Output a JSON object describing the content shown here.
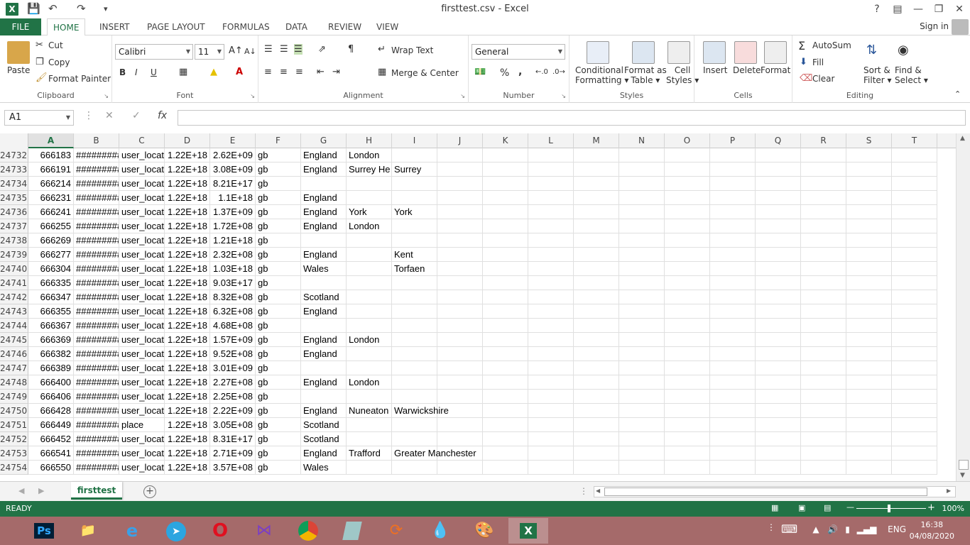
{
  "window": {
    "title": "firsttest.csv - Excel",
    "app_color": "#217346"
  },
  "tabs": [
    "FILE",
    "HOME",
    "INSERT",
    "PAGE LAYOUT",
    "FORMULAS",
    "DATA",
    "REVIEW",
    "VIEW"
  ],
  "active_tab": "HOME",
  "signin": "Sign in",
  "ribbon": {
    "clipboard": {
      "label": "Clipboard",
      "paste": "Paste",
      "cut": "Cut",
      "copy": "Copy",
      "format_painter": "Format Painter"
    },
    "font": {
      "label": "Font",
      "family": "Calibri",
      "size": "11",
      "bold": "B",
      "italic": "I",
      "underline": "U"
    },
    "alignment": {
      "label": "Alignment",
      "wrap_text": "Wrap Text",
      "merge_center": "Merge & Center"
    },
    "number": {
      "label": "Number",
      "format": "General",
      "percent": "%",
      "comma": ","
    },
    "styles": {
      "label": "Styles",
      "conditional": "Conditional",
      "conditional2": "Formatting",
      "format_table": "Format as",
      "format_table2": "Table",
      "cell_styles": "Cell",
      "cell_styles2": "Styles"
    },
    "cells": {
      "label": "Cells",
      "insert": "Insert",
      "delete": "Delete",
      "format": "Format"
    },
    "editing": {
      "label": "Editing",
      "autosum": "AutoSum",
      "fill": "Fill",
      "clear": "Clear",
      "sort": "Sort &",
      "sort2": "Filter",
      "find": "Find &",
      "find2": "Select"
    }
  },
  "formula_bar": {
    "name_box": "A1",
    "fx": "fx",
    "value": ""
  },
  "columns": [
    "A",
    "B",
    "C",
    "D",
    "E",
    "F",
    "G",
    "H",
    "I",
    "J",
    "K",
    "L",
    "M",
    "N",
    "O",
    "P",
    "Q",
    "R",
    "S",
    "T"
  ],
  "rows": [
    {
      "n": "24732",
      "a": "666183",
      "b": "#########",
      "c": "user_locat",
      "d": "1.22E+18",
      "e": "2.62E+09",
      "f": "gb",
      "g": "England",
      "h": "London",
      "i": ""
    },
    {
      "n": "24733",
      "a": "666191",
      "b": "#########",
      "c": "user_locat",
      "d": "1.22E+18",
      "e": "3.08E+09",
      "f": "gb",
      "g": "England",
      "h": "Surrey He",
      "i": "Surrey"
    },
    {
      "n": "24734",
      "a": "666214",
      "b": "#########",
      "c": "user_locat",
      "d": "1.22E+18",
      "e": "8.21E+17",
      "f": "gb",
      "g": "",
      "h": "",
      "i": ""
    },
    {
      "n": "24735",
      "a": "666231",
      "b": "#########",
      "c": "user_locat",
      "d": "1.22E+18",
      "e": "1.1E+18",
      "f": "gb",
      "g": "England",
      "h": "",
      "i": ""
    },
    {
      "n": "24736",
      "a": "666241",
      "b": "#########",
      "c": "user_locat",
      "d": "1.22E+18",
      "e": "1.37E+09",
      "f": "gb",
      "g": "England",
      "h": "York",
      "i": "York"
    },
    {
      "n": "24737",
      "a": "666255",
      "b": "#########",
      "c": "user_locat",
      "d": "1.22E+18",
      "e": "1.72E+08",
      "f": "gb",
      "g": "England",
      "h": "London",
      "i": ""
    },
    {
      "n": "24738",
      "a": "666269",
      "b": "#########",
      "c": "user_locat",
      "d": "1.22E+18",
      "e": "1.21E+18",
      "f": "gb",
      "g": "",
      "h": "",
      "i": ""
    },
    {
      "n": "24739",
      "a": "666277",
      "b": "#########",
      "c": "user_locat",
      "d": "1.22E+18",
      "e": "2.32E+08",
      "f": "gb",
      "g": "England",
      "h": "",
      "i": "Kent"
    },
    {
      "n": "24740",
      "a": "666304",
      "b": "#########",
      "c": "user_locat",
      "d": "1.22E+18",
      "e": "1.03E+18",
      "f": "gb",
      "g": "Wales",
      "h": "",
      "i": "Torfaen"
    },
    {
      "n": "24741",
      "a": "666335",
      "b": "#########",
      "c": "user_locat",
      "d": "1.22E+18",
      "e": "9.03E+17",
      "f": "gb",
      "g": "",
      "h": "",
      "i": ""
    },
    {
      "n": "24742",
      "a": "666347",
      "b": "#########",
      "c": "user_locat",
      "d": "1.22E+18",
      "e": "8.32E+08",
      "f": "gb",
      "g": "Scotland",
      "h": "",
      "i": ""
    },
    {
      "n": "24743",
      "a": "666355",
      "b": "#########",
      "c": "user_locat",
      "d": "1.22E+18",
      "e": "6.32E+08",
      "f": "gb",
      "g": "England",
      "h": "",
      "i": ""
    },
    {
      "n": "24744",
      "a": "666367",
      "b": "#########",
      "c": "user_locat",
      "d": "1.22E+18",
      "e": "4.68E+08",
      "f": "gb",
      "g": "",
      "h": "",
      "i": ""
    },
    {
      "n": "24745",
      "a": "666369",
      "b": "#########",
      "c": "user_locat",
      "d": "1.22E+18",
      "e": "1.57E+09",
      "f": "gb",
      "g": "England",
      "h": "London",
      "i": ""
    },
    {
      "n": "24746",
      "a": "666382",
      "b": "#########",
      "c": "user_locat",
      "d": "1.22E+18",
      "e": "9.52E+08",
      "f": "gb",
      "g": "England",
      "h": "",
      "i": ""
    },
    {
      "n": "24747",
      "a": "666389",
      "b": "#########",
      "c": "user_locat",
      "d": "1.22E+18",
      "e": "3.01E+09",
      "f": "gb",
      "g": "",
      "h": "",
      "i": ""
    },
    {
      "n": "24748",
      "a": "666400",
      "b": "#########",
      "c": "user_locat",
      "d": "1.22E+18",
      "e": "2.27E+08",
      "f": "gb",
      "g": "England",
      "h": "London",
      "i": ""
    },
    {
      "n": "24749",
      "a": "666406",
      "b": "#########",
      "c": "user_locat",
      "d": "1.22E+18",
      "e": "2.25E+08",
      "f": "gb",
      "g": "",
      "h": "",
      "i": ""
    },
    {
      "n": "24750",
      "a": "666428",
      "b": "#########",
      "c": "user_locat",
      "d": "1.22E+18",
      "e": "2.22E+09",
      "f": "gb",
      "g": "England",
      "h": "Nuneaton",
      "i": "Warwickshire"
    },
    {
      "n": "24751",
      "a": "666449",
      "b": "#########",
      "c": "place",
      "d": "1.22E+18",
      "e": "3.05E+08",
      "f": "gb",
      "g": "Scotland",
      "h": "",
      "i": ""
    },
    {
      "n": "24752",
      "a": "666452",
      "b": "#########",
      "c": "user_locat",
      "d": "1.22E+18",
      "e": "8.31E+17",
      "f": "gb",
      "g": "Scotland",
      "h": "",
      "i": ""
    },
    {
      "n": "24753",
      "a": "666541",
      "b": "#########",
      "c": "user_locat",
      "d": "1.22E+18",
      "e": "2.71E+09",
      "f": "gb",
      "g": "England",
      "h": "Trafford",
      "i": "Greater Manchester"
    },
    {
      "n": "24754",
      "a": "666550",
      "b": "#########",
      "c": "user_locat",
      "d": "1.22E+18",
      "e": "3.57E+08",
      "f": "gb",
      "g": "Wales",
      "h": "",
      "i": ""
    }
  ],
  "sheet": {
    "name": "firsttest",
    "add_icon": "plus-circle-icon"
  },
  "status": {
    "ready": "READY",
    "zoom": "100%"
  },
  "taskbar": {
    "apps": [
      "Ps",
      "Explorer",
      "IE",
      "Telegram",
      "Opera",
      "Visual Studio",
      "Chrome",
      "App",
      "App",
      "App",
      "Paint",
      "Excel"
    ],
    "lang": "ENG",
    "time": "16:38",
    "date": "04/08/2020",
    "color": "#a56a6a"
  }
}
